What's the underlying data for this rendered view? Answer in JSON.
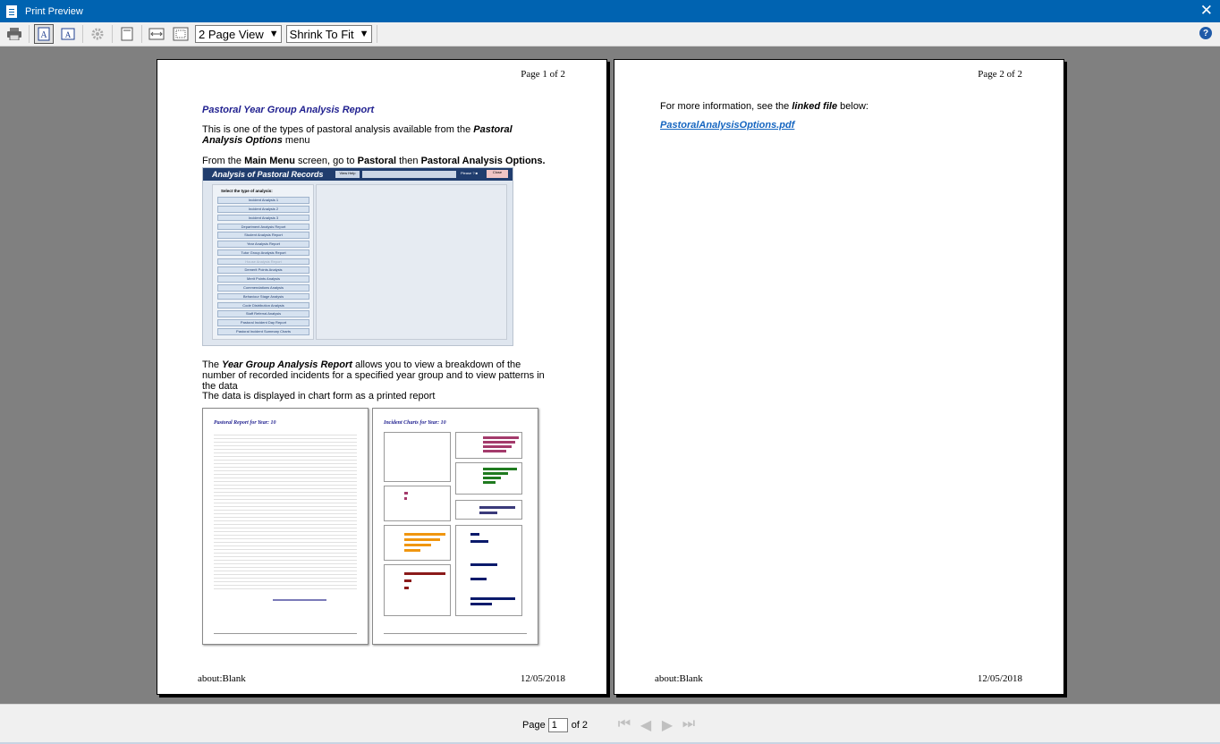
{
  "window": {
    "title": "Print Preview",
    "close_glyph": "✕",
    "app_icon": "document-icon"
  },
  "toolbar": {
    "print_glyph": "🖶",
    "portrait_glyph": "A",
    "landscape_glyph": "A",
    "settings_glyph": "⚙",
    "page_layout": "2 Page View",
    "zoom": "Shrink To Fit",
    "help_glyph": "?"
  },
  "page1": {
    "page_number": "Page 1 of 2",
    "report_title": "Pastoral Year Group Analysis Report",
    "para1_pre": "This is one of the types of pastoral analysis available from the ",
    "para1_bold": "Pastoral Analysis Options",
    "para1_post": " menu",
    "para2_pre": "From the ",
    "para2_b1": "Main Menu",
    "para2_mid1": " screen, go to ",
    "para2_b2": "Pastoral",
    "para2_mid2": " then ",
    "para2_b3": "Pastoral Analysis Options.",
    "para3_pre": "The ",
    "para3_bold": "Year Group Analysis Report",
    "para3_post": " allows you to view a breakdown of the number of recorded incidents for a specified year group and to view patterns in the data",
    "para4": "The data is displayed in chart form as a printed report",
    "footer_left": "about:Blank",
    "footer_right": "12/05/2018",
    "screenshot": {
      "title": "Analysis of Pastoral Records",
      "view_help": "View Help",
      "please": "Please ? ■",
      "close": "Close",
      "select_label": "Select the type of analysis:",
      "items": [
        "Incident Analysis 1",
        "Incident Analysis 2",
        "Incident Analysis 3",
        "Department Analysis Report",
        "Student Analysis Report",
        "Year Analysis Report",
        "Tutor Group Analysis Report",
        "House Analysis Report",
        "Demerit Points Analysis",
        "Merit Points Analysis",
        "Commendations Analysis",
        "Behaviour Stage Analysis",
        "Code Distribution Analysis",
        "Staff Referral Analysis",
        "Pastoral Incident Day Report",
        "Pastoral Incident Summary Charts"
      ]
    },
    "thumb_left_title": "Pastoral Report for Year:  10",
    "thumb_right_title": "Incident Charts for Year:  10"
  },
  "page2": {
    "page_number": "Page 2 of 2",
    "para_pre": "For more information, see the ",
    "para_bold": "linked file",
    "para_post": " below:",
    "link": "PastoralAnalysisOptions.pdf",
    "footer_left": "about:Blank",
    "footer_right": "12/05/2018"
  },
  "status": {
    "page_label": "Page",
    "page_value": "1",
    "of_label": "of 2",
    "nav_first": "⏮",
    "nav_prev": "◀",
    "nav_next": "▶",
    "nav_last": "⏭"
  }
}
